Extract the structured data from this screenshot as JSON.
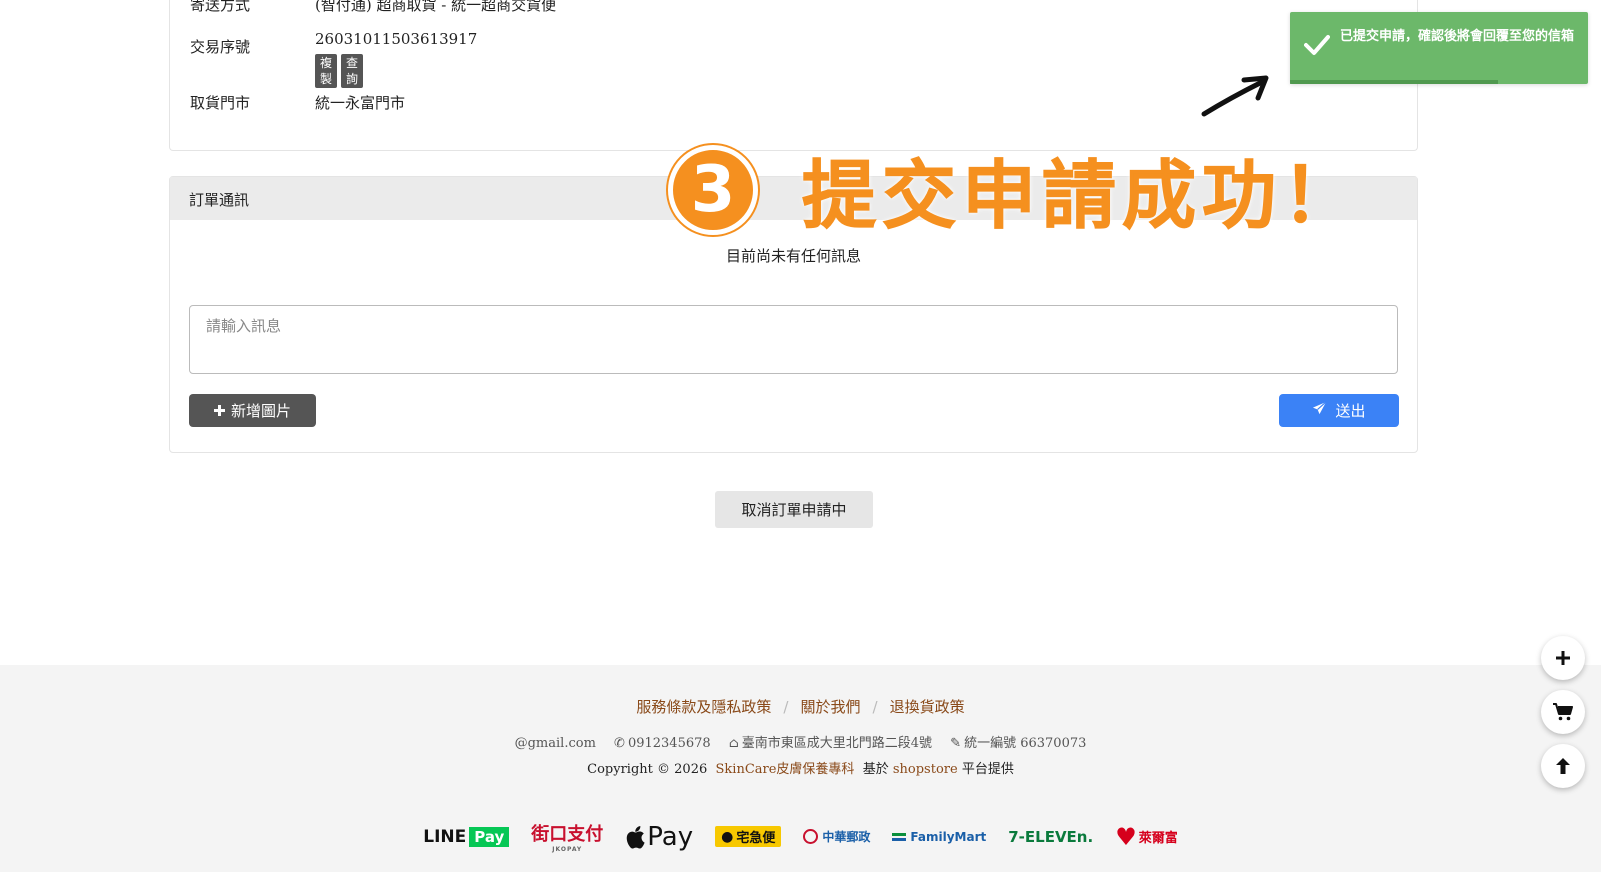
{
  "order_info": {
    "shipping_label": "寄送方式",
    "shipping_value": "(智付通) 超商取貨 - 統一超商交貨便",
    "txn_label": "交易序號",
    "txn_value": "26031011503613917",
    "copy_tag": "複製",
    "query_tag": "查詢",
    "store_label": "取貨門市",
    "store_value": "統一永富門市"
  },
  "messages": {
    "header": "訂單通訊",
    "empty_text": "目前尚未有任何訊息",
    "input_placeholder": "請輸入訊息",
    "add_image_label": "新增圖片",
    "send_label": "送出"
  },
  "cancel_button": "取消訂單申請中",
  "annotation": {
    "number": "3",
    "text": "提交申請成功！"
  },
  "toast": {
    "message": "已提交申請，確認後將會回覆至您的信箱",
    "color": "#6cb86a"
  },
  "footer": {
    "links": [
      "服務條款及隱私政策",
      "關於我們",
      "退換貨政策"
    ],
    "email": "@gmail.com",
    "phone": "0912345678",
    "address": "臺南市東區成大里北門路二段4號",
    "tax_id": "統一編號 66370073",
    "copyright_prefix": "Copyright © 2026",
    "brand": "SkinCare皮膚保養專科",
    "based_on": "基於",
    "platform": "shopstore",
    "provided": "平台提供"
  },
  "payment_logos": {
    "linepay_line": "LINE",
    "linepay_pay": "Pay",
    "jkopay": "街口支付",
    "jkopay_sub": "JKOPAY",
    "applepay": "Pay",
    "tqbin": "宅急便",
    "chunghwa_post": "中華郵政",
    "familymart": "FamilyMart",
    "seven_eleven": "7-ELEVEn.",
    "hilife": "萊爾富"
  },
  "icons": {
    "toast": "check-icon",
    "add": "plus-icon",
    "send": "paper-plane-icon",
    "fab_add": "plus-icon",
    "fab_cart": "cart-icon",
    "fab_top": "arrow-up-icon"
  },
  "colors": {
    "accent_orange": "#f5901f",
    "send_blue": "#3b82f6",
    "link_brown": "#8a4a1a"
  }
}
